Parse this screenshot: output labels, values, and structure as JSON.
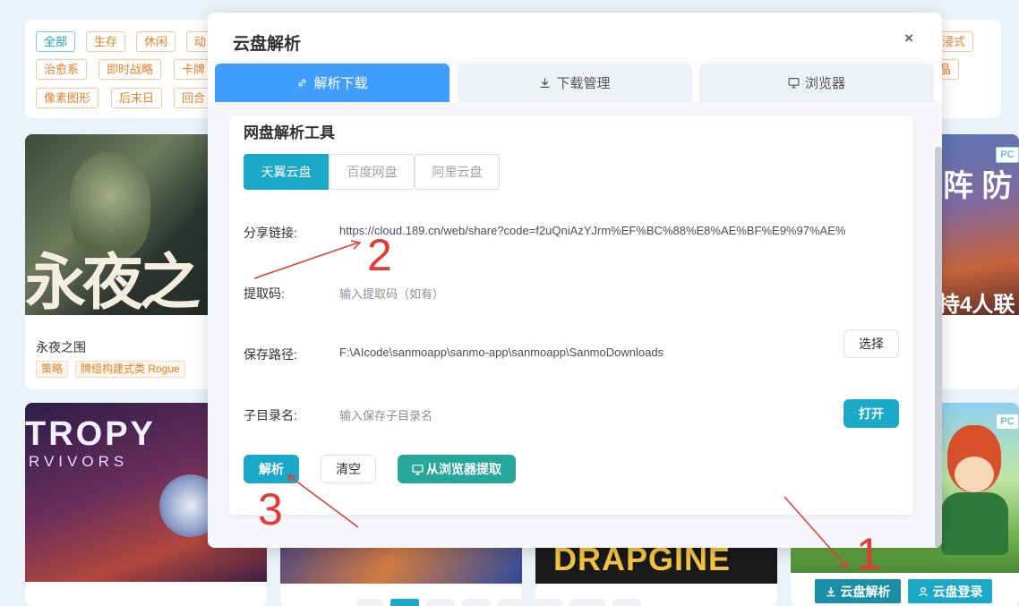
{
  "background": {
    "tags": [
      {
        "label": "全部",
        "active": true
      },
      {
        "label": "生存"
      },
      {
        "label": "休闲"
      },
      {
        "label": "动"
      },
      {
        "label": "治愈系"
      },
      {
        "label": "即时战略"
      },
      {
        "label": "卡牌"
      },
      {
        "label": "像素图形"
      },
      {
        "label": "后末日"
      },
      {
        "label": "回合"
      },
      {
        "label": "沉浸式"
      },
      {
        "label": "晶"
      }
    ],
    "cards": [
      {
        "title": "永夜之围",
        "chips": [
          "策略",
          "牌组构建式类 Rogue"
        ],
        "art_text": "永夜之"
      },
      {
        "art_text": "TROPY",
        "art_subtext": "RVIVORS"
      },
      {
        "art_text": "DRAPGINE"
      },
      {
        "art_text": "阵 防",
        "art_subtext": "持4人联",
        "badge": "PC"
      },
      {
        "badge": "PC"
      }
    ]
  },
  "dialog": {
    "title": "云盘解析",
    "close": "×",
    "tabs": [
      {
        "label": "解析下载",
        "icon": "link-icon",
        "active": true
      },
      {
        "label": "下载管理",
        "icon": "download-icon"
      },
      {
        "label": "浏览器",
        "icon": "monitor-icon"
      }
    ],
    "panel_title": "网盘解析工具",
    "sources": [
      "天翼云盘",
      "百度网盘",
      "阿里云盘"
    ],
    "fields": {
      "share_link_label": "分享链接:",
      "share_link_value": "https://cloud.189.cn/web/share?code=f2uQniAzYJrm%EF%BC%88%E8%AE%BF%E9%97%AE%",
      "code_label": "提取码:",
      "code_placeholder": "输入提取码（如有）",
      "path_label": "保存路径:",
      "path_value": "F:\\AIcode\\sanmoapp\\sanmo-app\\sanmoapp\\SanmoDownloads",
      "path_button": "选择",
      "subdir_label": "子目录名:",
      "subdir_placeholder": "输入保存子目录名",
      "subdir_button": "打开"
    },
    "actions": {
      "parse": "解析",
      "clear": "清空",
      "from_browser": "从浏览器提取"
    }
  },
  "floating": {
    "cloud_parse": "云盘解析",
    "cloud_login": "云盘登录"
  },
  "annotations": [
    "1",
    "2",
    "3"
  ],
  "colors": {
    "primary_blue": "#409eff",
    "teal": "#1ba9c9",
    "green_teal": "#27a69a",
    "annotation_red": "#e53935",
    "tag_orange": "#e6822a"
  }
}
